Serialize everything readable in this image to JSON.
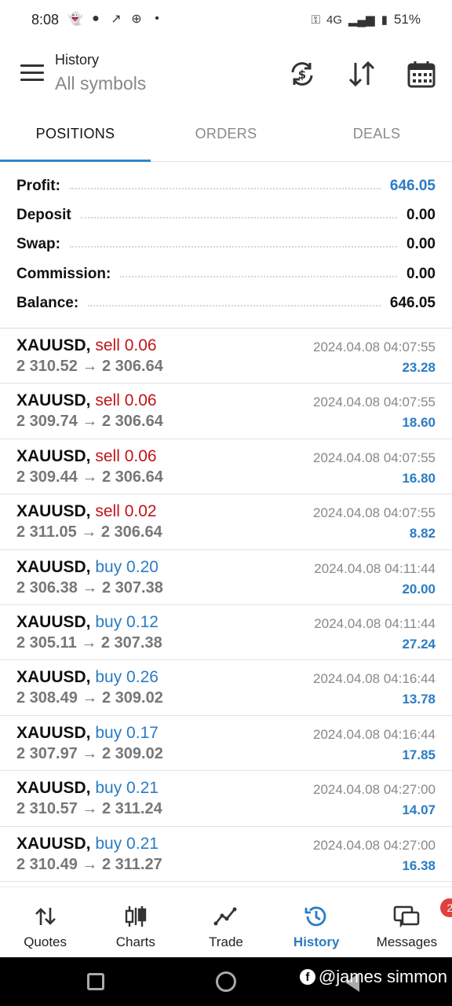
{
  "status_bar": {
    "time": "8:08",
    "icons": [
      "snapchat-icon",
      "chat-icon",
      "missed-call-icon",
      "cross-icon",
      "dot-icon"
    ],
    "network": "4G",
    "battery": "51%"
  },
  "header": {
    "title": "History",
    "subtitle": "All symbols",
    "icons": [
      "sync-icon",
      "sort-icon",
      "calendar-icon"
    ]
  },
  "tabs": [
    {
      "label": "POSITIONS",
      "active": true
    },
    {
      "label": "ORDERS",
      "active": false
    },
    {
      "label": "DEALS",
      "active": false
    }
  ],
  "summary": [
    {
      "label": "Profit:",
      "value": "646.05",
      "highlight": true
    },
    {
      "label": "Deposit",
      "value": "0.00",
      "highlight": false
    },
    {
      "label": "Swap:",
      "value": "0.00",
      "highlight": false
    },
    {
      "label": "Commission:",
      "value": "0.00",
      "highlight": false
    },
    {
      "label": "Balance:",
      "value": "646.05",
      "highlight": false
    }
  ],
  "positions": [
    {
      "symbol": "XAUUSD,",
      "side": "sell",
      "volume": "sell 0.06",
      "open": "2 310.52",
      "close": "2 306.64",
      "time": "2024.04.08 04:07:55",
      "profit": "23.28"
    },
    {
      "symbol": "XAUUSD,",
      "side": "sell",
      "volume": "sell 0.06",
      "open": "2 309.74",
      "close": "2 306.64",
      "time": "2024.04.08 04:07:55",
      "profit": "18.60"
    },
    {
      "symbol": "XAUUSD,",
      "side": "sell",
      "volume": "sell 0.06",
      "open": "2 309.44",
      "close": "2 306.64",
      "time": "2024.04.08 04:07:55",
      "profit": "16.80"
    },
    {
      "symbol": "XAUUSD,",
      "side": "sell",
      "volume": "sell 0.02",
      "open": "2 311.05",
      "close": "2 306.64",
      "time": "2024.04.08 04:07:55",
      "profit": "8.82"
    },
    {
      "symbol": "XAUUSD,",
      "side": "buy",
      "volume": "buy 0.20",
      "open": "2 306.38",
      "close": "2 307.38",
      "time": "2024.04.08 04:11:44",
      "profit": "20.00"
    },
    {
      "symbol": "XAUUSD,",
      "side": "buy",
      "volume": "buy 0.12",
      "open": "2 305.11",
      "close": "2 307.38",
      "time": "2024.04.08 04:11:44",
      "profit": "27.24"
    },
    {
      "symbol": "XAUUSD,",
      "side": "buy",
      "volume": "buy 0.26",
      "open": "2 308.49",
      "close": "2 309.02",
      "time": "2024.04.08 04:16:44",
      "profit": "13.78"
    },
    {
      "symbol": "XAUUSD,",
      "side": "buy",
      "volume": "buy 0.17",
      "open": "2 307.97",
      "close": "2 309.02",
      "time": "2024.04.08 04:16:44",
      "profit": "17.85"
    },
    {
      "symbol": "XAUUSD,",
      "side": "buy",
      "volume": "buy 0.21",
      "open": "2 310.57",
      "close": "2 311.24",
      "time": "2024.04.08 04:27:00",
      "profit": "14.07"
    },
    {
      "symbol": "XAUUSD,",
      "side": "buy",
      "volume": "buy 0.21",
      "open": "2 310.49",
      "close": "2 311.27",
      "time": "2024.04.08 04:27:00",
      "profit": "16.38"
    }
  ],
  "arrow": "→",
  "bottom_nav": [
    {
      "label": "Quotes",
      "icon": "quotes-icon",
      "active": false
    },
    {
      "label": "Charts",
      "icon": "charts-icon",
      "active": false
    },
    {
      "label": "Trade",
      "icon": "trade-icon",
      "active": false
    },
    {
      "label": "History",
      "icon": "history-icon",
      "active": true
    },
    {
      "label": "Messages",
      "icon": "messages-icon",
      "active": false,
      "badge": "2"
    }
  ],
  "watermark": "@james simmon",
  "colors": {
    "accent": "#2a7cc4",
    "sell": "#c0141a",
    "muted": "#777777"
  }
}
